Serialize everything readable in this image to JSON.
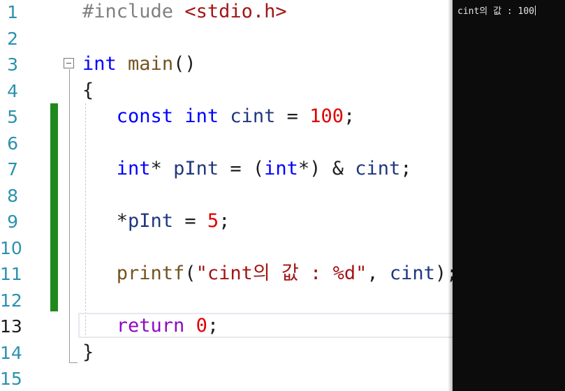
{
  "editor": {
    "line_numbers": [
      "1",
      "2",
      "3",
      "4",
      "5",
      "6",
      "7",
      "8",
      "9",
      "10",
      "11",
      "12",
      "13",
      "14",
      "15"
    ],
    "active_line": "13",
    "lines": [
      {
        "tokens": [
          {
            "t": "#include ",
            "c": "pp"
          },
          {
            "t": "<stdio.h>",
            "c": "inc"
          }
        ]
      },
      {
        "tokens": []
      },
      {
        "tokens": [
          {
            "t": "int",
            "c": "kw"
          },
          {
            "t": " ",
            "c": "punc"
          },
          {
            "t": "main",
            "c": "fn"
          },
          {
            "t": "()",
            "c": "punc"
          }
        ]
      },
      {
        "tokens": [
          {
            "t": "{",
            "c": "punc"
          }
        ]
      },
      {
        "tokens": [
          {
            "t": "   ",
            "c": "punc"
          },
          {
            "t": "const",
            "c": "kw"
          },
          {
            "t": " ",
            "c": "punc"
          },
          {
            "t": "int",
            "c": "kw"
          },
          {
            "t": " ",
            "c": "punc"
          },
          {
            "t": "cint",
            "c": "var"
          },
          {
            "t": " = ",
            "c": "punc"
          },
          {
            "t": "100",
            "c": "num"
          },
          {
            "t": ";",
            "c": "punc"
          }
        ]
      },
      {
        "tokens": []
      },
      {
        "tokens": [
          {
            "t": "   ",
            "c": "punc"
          },
          {
            "t": "int",
            "c": "kw"
          },
          {
            "t": "* ",
            "c": "punc"
          },
          {
            "t": "pInt",
            "c": "var"
          },
          {
            "t": " = (",
            "c": "punc"
          },
          {
            "t": "int",
            "c": "kw"
          },
          {
            "t": "*) & ",
            "c": "punc"
          },
          {
            "t": "cint",
            "c": "var"
          },
          {
            "t": ";",
            "c": "punc"
          }
        ]
      },
      {
        "tokens": []
      },
      {
        "tokens": [
          {
            "t": "   *",
            "c": "punc"
          },
          {
            "t": "pInt",
            "c": "var"
          },
          {
            "t": " = ",
            "c": "punc"
          },
          {
            "t": "5",
            "c": "num"
          },
          {
            "t": ";",
            "c": "punc"
          }
        ]
      },
      {
        "tokens": []
      },
      {
        "tokens": [
          {
            "t": "   ",
            "c": "punc"
          },
          {
            "t": "printf",
            "c": "fn"
          },
          {
            "t": "(",
            "c": "punc"
          },
          {
            "t": "\"cint의 값 : %d\"",
            "c": "str"
          },
          {
            "t": ", ",
            "c": "punc"
          },
          {
            "t": "cint",
            "c": "var"
          },
          {
            "t": ");",
            "c": "punc"
          }
        ]
      },
      {
        "tokens": []
      },
      {
        "tokens": [
          {
            "t": "   ",
            "c": "punc"
          },
          {
            "t": "return",
            "c": "rkw"
          },
          {
            "t": " ",
            "c": "punc"
          },
          {
            "t": "0",
            "c": "num"
          },
          {
            "t": ";",
            "c": "punc"
          }
        ]
      },
      {
        "tokens": [
          {
            "t": "}",
            "c": "punc"
          }
        ]
      },
      {
        "tokens": []
      }
    ]
  },
  "console": {
    "output": "cint의 값 : 100"
  },
  "colors": {
    "change_bar": "#1e8a1e",
    "console_bg": "#0c0c0c",
    "line_number": "#2b91af"
  }
}
